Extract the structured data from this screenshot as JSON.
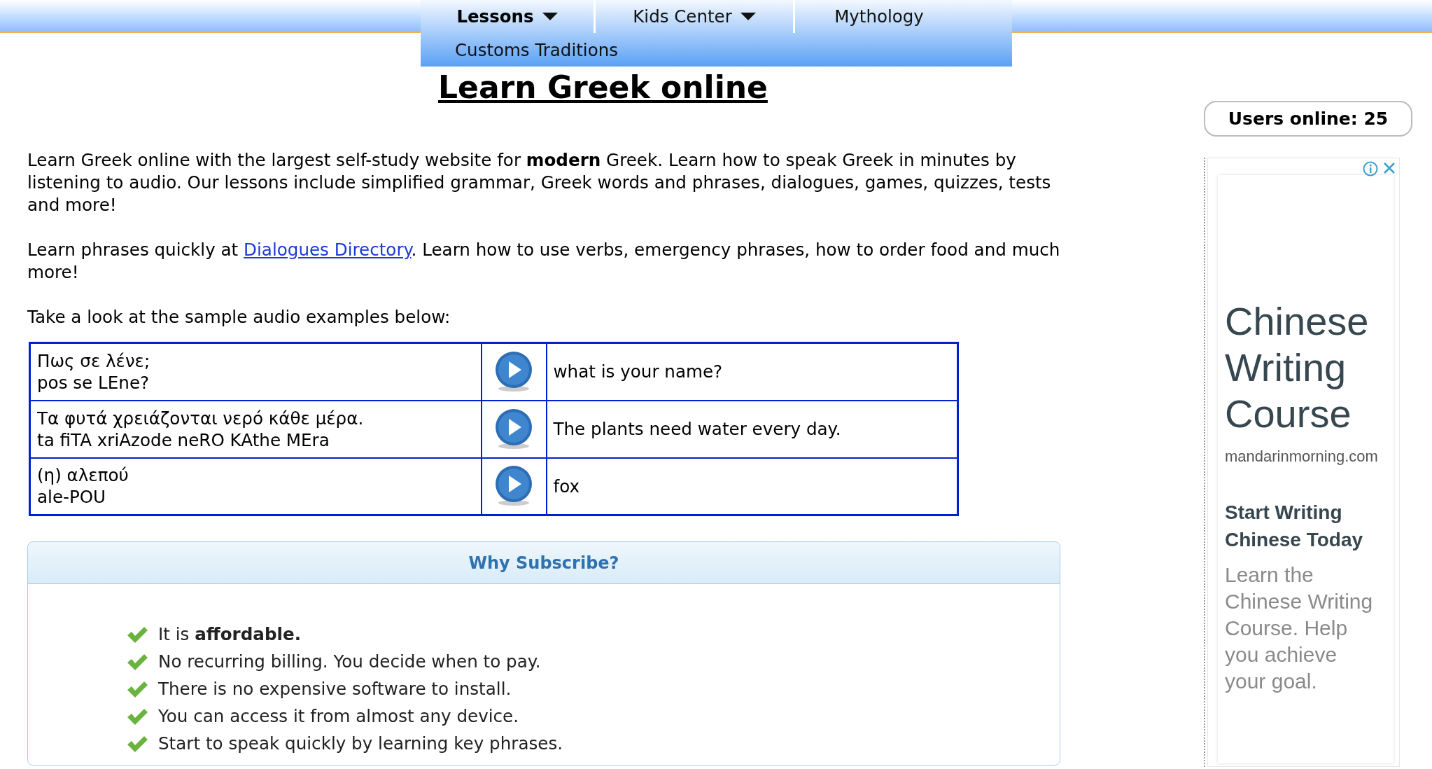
{
  "nav": {
    "items": [
      {
        "label": "Lessons",
        "selected": true,
        "has_menu": true
      },
      {
        "label": "Kids Center",
        "selected": false,
        "has_menu": true
      },
      {
        "label": "Mythology",
        "selected": false,
        "has_menu": false
      },
      {
        "label": "Customs Traditions",
        "selected": false,
        "has_menu": false
      }
    ]
  },
  "title": "Learn Greek online",
  "intro": [
    {
      "kind": "text",
      "text": "Learn Greek online with the largest self-study website for **modern** Greek. Learn how to speak Greek in minutes by listening to audio. Our lessons include simplified grammar, Greek words and phrases, dialogues, games, quizzes, tests and more!"
    },
    {
      "kind": "link",
      "before": "Learn phrases quickly at ",
      "link": "Dialogues Directory",
      "after": ". Learn how to use verbs, emergency phrases, how to order food and much more!"
    },
    {
      "kind": "text",
      "text": "Take a look at the sample audio examples below:"
    }
  ],
  "audio_table": {
    "rows": [
      {
        "greek": "Πως σε λένε;",
        "transliteration": "pos se LEne?",
        "english": "what is your name?"
      },
      {
        "greek": "Τα φυτά χρειάζονται νερό κάθε μέρα.",
        "transliteration": "ta fiTA xriAzode neRO KAthe MEra",
        "english": "The plants need water every day."
      },
      {
        "greek": "(η) αλεπού",
        "transliteration": "ale-POU",
        "english": "fox"
      }
    ]
  },
  "subscribe": {
    "title": "Why Subscribe?",
    "reasons": [
      "It is **affordable.**",
      "No recurring billing. You decide when to pay.",
      "There is no expensive software to install.",
      "You can access it from almost any device.",
      "Start to speak quickly by learning key phrases."
    ]
  },
  "users_online": "Users online: 25",
  "ad": {
    "headline": "Chinese Writing Course",
    "domain": "mandarinmorning.com",
    "subhead": "Start Writing Chinese Today",
    "body": "Learn the Chinese Writing Course. Help you achieve your goal."
  }
}
